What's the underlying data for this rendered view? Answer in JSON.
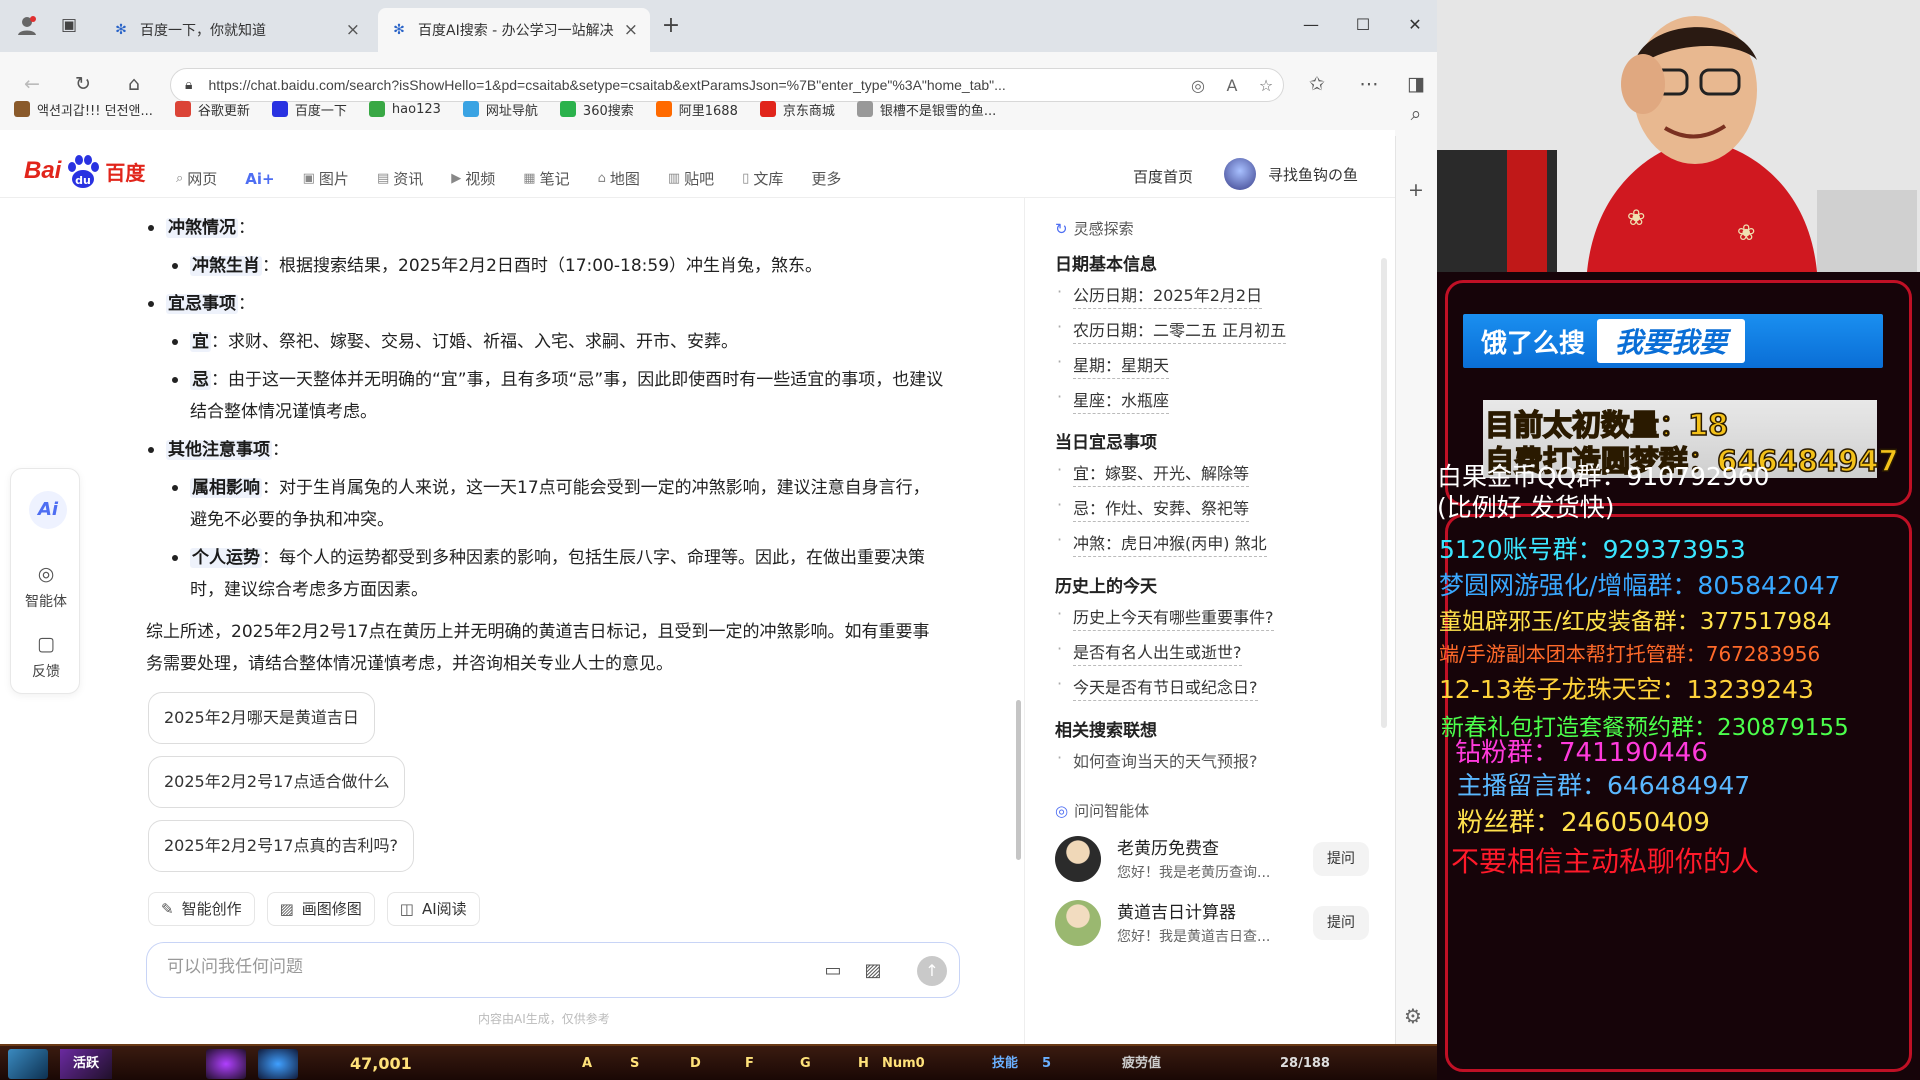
{
  "tabs": [
    {
      "label": "百度一下，你就知道",
      "close": "×"
    },
    {
      "label": "百度AI搜索 - 办公学习一站解决",
      "close": "×"
    }
  ],
  "new_tab": "+",
  "window_controls": {
    "minimize": "—",
    "maximize": "☐",
    "close": "✕"
  },
  "address": {
    "url": "https://chat.baidu.com/search?isShowHello=1&pd=csaitab&setype=csaitab&extParamsJson=%7B\"enter_type\"%3A\"home_tab\"..."
  },
  "bookmarks": [
    {
      "label": "액션괴갑!!! 던전앤...",
      "color": "#8a5a2b"
    },
    {
      "label": "谷歌更新",
      "color": "#db4437"
    },
    {
      "label": "百度一下",
      "color": "#2932e1"
    },
    {
      "label": "hao123",
      "color": "#39a845"
    },
    {
      "label": "网址导航",
      "color": "#3aa3e3"
    },
    {
      "label": "360搜索",
      "color": "#2bb24c"
    },
    {
      "label": "阿里1688",
      "color": "#ff6a00"
    },
    {
      "label": "京东商城",
      "color": "#e1251b"
    },
    {
      "label": "银槽不是银雪的鱼...",
      "color": "#999999"
    }
  ],
  "logo": {
    "bai": "Bai",
    "cn": "百度"
  },
  "search_tabs": [
    {
      "label": "网页",
      "icon": "⌕"
    },
    {
      "label": "Ai+",
      "icon": ""
    },
    {
      "label": "图片",
      "icon": "▣"
    },
    {
      "label": "资讯",
      "icon": "▤"
    },
    {
      "label": "视频",
      "icon": "▶"
    },
    {
      "label": "笔记",
      "icon": "▦"
    },
    {
      "label": "地图",
      "icon": "⌂"
    },
    {
      "label": "贴吧",
      "icon": "▥"
    },
    {
      "label": "文库",
      "icon": "▯"
    },
    {
      "label": "更多",
      "icon": ""
    }
  ],
  "header": {
    "home": "百度首页",
    "username": "寻找鱼钩の鱼"
  },
  "left_tools": {
    "ai": "Ai",
    "agent": "智能体",
    "feedback": "反馈"
  },
  "answer": {
    "conflict_title": "冲煞情况",
    "conflict_kw": "冲煞生肖",
    "conflict_text": "：根据搜索结果，2025年2月2日酉时（17:00-18:59）冲生肖兔，煞东。",
    "yiji_title": "宜忌事项",
    "yi_kw": "宜",
    "yi_text": "：求财、祭祀、嫁娶、交易、订婚、祈福、入宅、求嗣、开市、安葬。",
    "ji_kw": "忌",
    "ji_text": "：由于这一天整体并无明确的“宜”事，且有多项“忌”事，因此即使酉时有一些适宜的事项，也建议结合整体情况谨慎考虑。",
    "other_title": "其他注意事项",
    "zodiac_kw": "属相影响",
    "zodiac_text": "：对于生肖属兔的人来说，这一天17点可能会受到一定的冲煞影响，建议注意自身言行，避免不必要的争执和冲突。",
    "fortune_kw": "个人运势",
    "fortune_text": "：每个人的运势都受到多种因素的影响，包括生辰八字、命理等。因此，在做出重要决策时，建议综合考虑多方面因素。",
    "summary": "综上所述，2025年2月2号17点在黄历上并无明确的黄道吉日标记，且受到一定的冲煞影响。如有重要事务需要处理，请结合整体情况谨慎考虑，并咨询相关专业人士的意见。"
  },
  "suggestions": [
    "2025年2月哪天是黄道吉日",
    "2025年2月2号17点适合做什么",
    "2025年2月2号17点真的吉利吗?"
  ],
  "tools": [
    {
      "label": "智能创作",
      "icon": "✎"
    },
    {
      "label": "画图修图",
      "icon": "▨"
    },
    {
      "label": "AI阅读",
      "icon": "◫"
    }
  ],
  "ask": {
    "placeholder": "可以问我任何问题",
    "disclaimer": "内容由AI生成，仅供参考"
  },
  "right_panel": {
    "inspire": "灵感探索",
    "date_title": "日期基本信息",
    "date_items": [
      "公历日期：2025年2月2日",
      "农历日期：二零二五 正月初五",
      "星期：星期天",
      "星座：水瓶座"
    ],
    "yiji_title": "当日宜忌事项",
    "yiji_items": [
      "宜：嫁娶、开光、解除等",
      "忌：作灶、安葬、祭祀等",
      "冲煞：虎日冲猴(丙申) 煞北"
    ],
    "history_title": "历史上的今天",
    "history_items": [
      "历史上今天有哪些重要事件?",
      "是否有名人出生或逝世?",
      "今天是否有节日或纪念日?"
    ],
    "related_title": "相关搜索联想",
    "related_items": [
      "如何查询当天的天气预报?"
    ],
    "agents_title": "问问智能体",
    "agents": [
      {
        "name": "老黄历免费查",
        "desc": "您好！我是老黄历查询...",
        "btn": "提问"
      },
      {
        "name": "黄道吉日计算器",
        "desc": "您好！我是黄道吉日查...",
        "btn": "提问"
      }
    ]
  },
  "taskbar": {
    "skill_label": "技能",
    "skill_value": "5",
    "gold": "47,001",
    "fatigue": "疲劳值",
    "fatigue_value": "28/188",
    "keys": [
      "活跃",
      "A",
      "S",
      "D",
      "F",
      "G",
      "H",
      "Num0"
    ]
  },
  "overlay": {
    "eleme_brand": "饿了么搜",
    "eleme_btn": "我要我要",
    "count_line": "目前太初数量：18",
    "dream_line": "自费打造圆梦群：646484947",
    "lines": [
      {
        "text": "白果金币QQ群：910792960",
        "color": "#ffffff"
      },
      {
        "text": "(比例好 发货快)",
        "color": "#ffffff"
      },
      {
        "text": "5120账号群：929373953",
        "color": "#3be6ff"
      },
      {
        "text": "梦圆网游强化/增幅群：805842047",
        "color": "#3aa8ff"
      },
      {
        "text": "童姐辟邪玉/红皮装备群：377517984",
        "color": "#ffe34d"
      },
      {
        "text": "端/手游副本团本帮打托管群：767283956",
        "color": "#ff6a2a"
      },
      {
        "text": "12-13卷子龙珠天空：13239243",
        "color": "#ffd23a"
      },
      {
        "text": "新春礼包打造套餐预约群：230879155",
        "color": "#4cff4c"
      },
      {
        "text": "钻粉群：741190446",
        "color": "#ff3bdc"
      },
      {
        "text": "主播留言群：646484947",
        "color": "#5ab8ff"
      },
      {
        "text": "粉丝群：246050409",
        "color": "#ffe14d"
      },
      {
        "text": "不要相信主动私聊你的人",
        "color": "#ff1a2a"
      }
    ]
  }
}
